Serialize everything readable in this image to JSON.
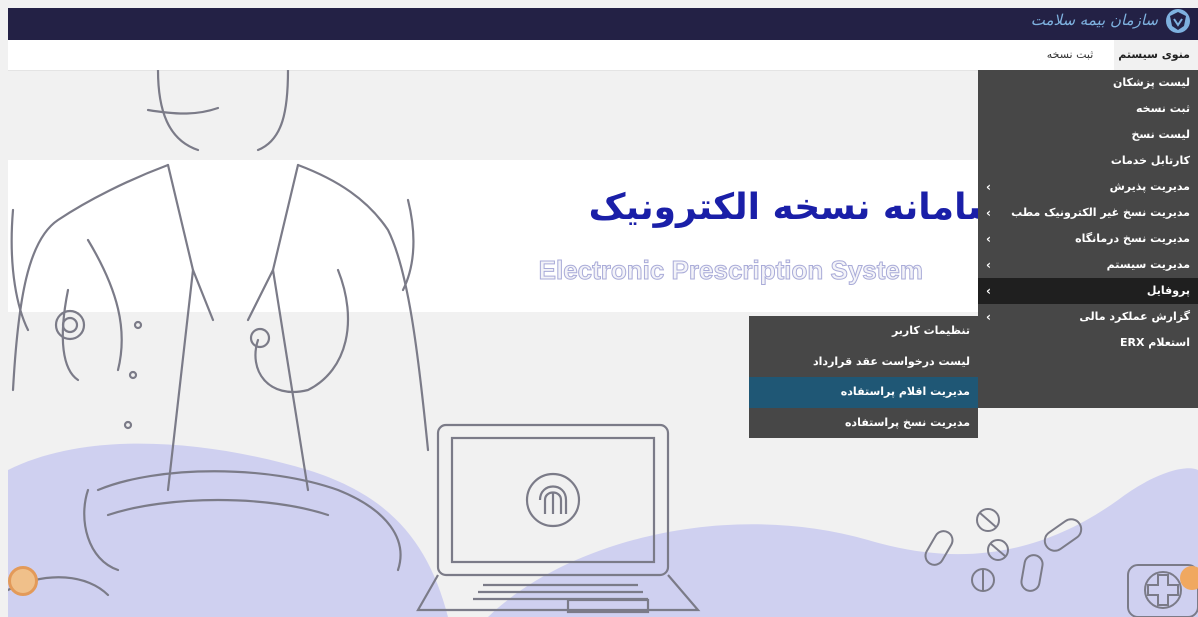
{
  "header": {
    "brand_text": "سازمان بیمه سلامت",
    "brand_logo": "shield-logo-icon"
  },
  "menubar": {
    "system_menu": "منوی سیستم",
    "register_rx": "ثبت نسخه"
  },
  "hero": {
    "title": "سامانه نسخه الکترونیک",
    "subtitle": "Electronic Prescription System"
  },
  "dropdown": {
    "items": [
      {
        "label": "لیست پزشکان",
        "has_sub": false
      },
      {
        "label": "ثبت نسخه",
        "has_sub": false
      },
      {
        "label": "لیست نسخ",
        "has_sub": false
      },
      {
        "label": "کارتابل خدمات",
        "has_sub": false
      },
      {
        "label": "مدیریت پذیرش",
        "has_sub": true
      },
      {
        "label": "مدیریت نسخ غیر الکترونیک مطب",
        "has_sub": true
      },
      {
        "label": "مدیریت نسخ درمانگاه",
        "has_sub": true
      },
      {
        "label": "مدیریت سیستم",
        "has_sub": true
      },
      {
        "label": "پروفایل",
        "has_sub": true
      },
      {
        "label": "گزارش عملکرد مالی",
        "has_sub": true
      },
      {
        "label": "استعلام ERX",
        "has_sub": false
      }
    ],
    "chevron": "‹"
  },
  "submenu": {
    "items": [
      {
        "label": "تنظیمات کاربر"
      },
      {
        "label": "لیست درخواست عقد قرارداد"
      },
      {
        "label": "مدیریت اقلام پراستفاده"
      },
      {
        "label": "مدیریت نسخ پراستفاده"
      }
    ]
  },
  "colors": {
    "header_bg": "#232145",
    "menu_bg": "#474747",
    "menu_active": "#1f1f1f",
    "submenu_highlight": "#1f5775",
    "title_blue": "#1a1fa8",
    "wave_lavender": "#cfd0f0"
  }
}
